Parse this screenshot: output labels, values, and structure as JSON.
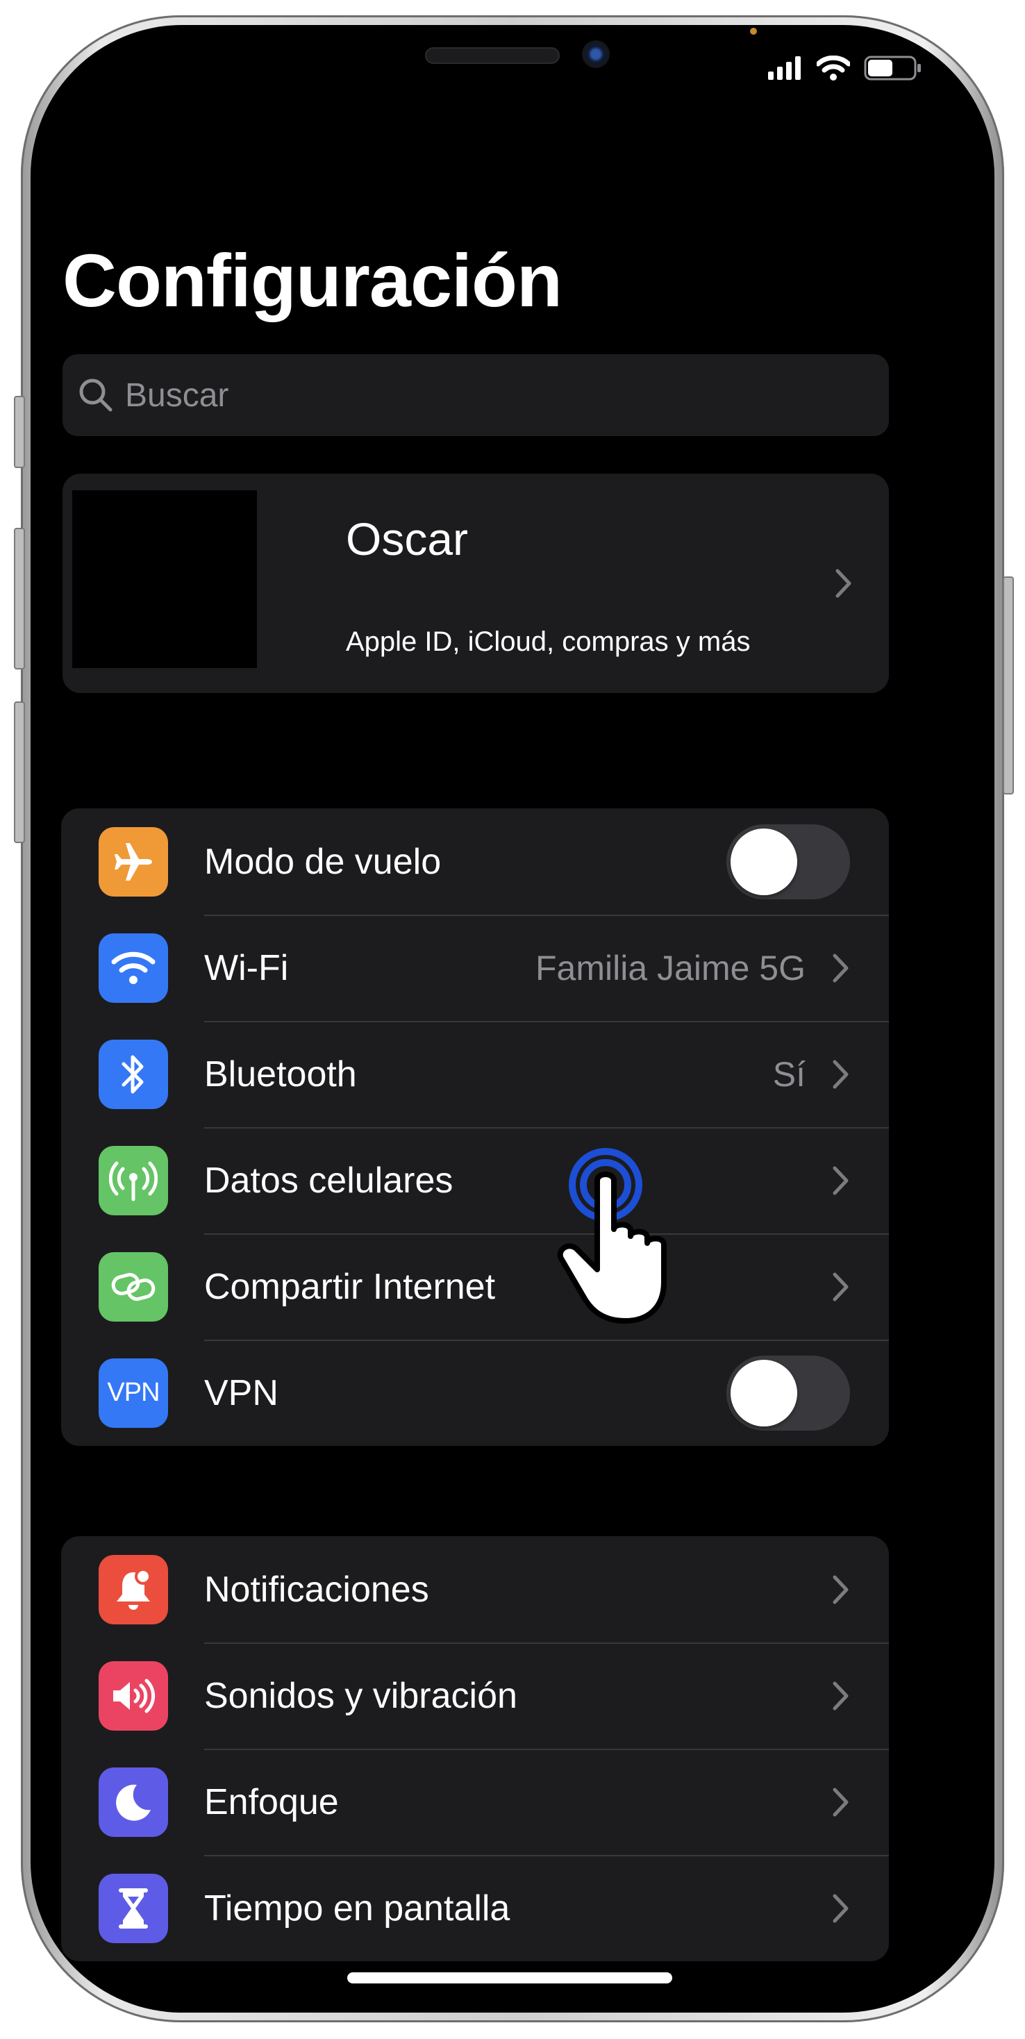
{
  "page": {
    "title": "Configuración"
  },
  "search": {
    "placeholder": "Buscar"
  },
  "profile": {
    "name": "Oscar",
    "subtitle": "Apple ID, iCloud, compras y más"
  },
  "connectivity": [
    {
      "label": "Modo de vuelo",
      "icon": "airplane-icon",
      "color": "#F09A37",
      "control": "toggle",
      "on": false
    },
    {
      "label": "Wi-Fi",
      "value": "Familia Jaime 5G",
      "icon": "wifi-icon",
      "color": "#3478F6",
      "control": "chevron"
    },
    {
      "label": "Bluetooth",
      "value": "Sí",
      "icon": "bluetooth-icon",
      "color": "#3478F6",
      "control": "chevron"
    },
    {
      "label": "Datos celulares",
      "icon": "antenna-icon",
      "color": "#65C466",
      "control": "chevron"
    },
    {
      "label": "Compartir Internet",
      "icon": "chain-link-icon",
      "color": "#65C466",
      "control": "chevron"
    },
    {
      "label": "VPN",
      "icon_text": "VPN",
      "icon": "vpn-icon",
      "color": "#3478F6",
      "control": "toggle",
      "on": false
    }
  ],
  "general": [
    {
      "label": "Notificaciones",
      "icon": "bell-icon",
      "color": "#EB4E3D"
    },
    {
      "label": "Sonidos y vibración",
      "icon": "speaker-icon",
      "color": "#EB4462"
    },
    {
      "label": "Enfoque",
      "icon": "moon-icon",
      "color": "#5E5CE6"
    },
    {
      "label": "Tiempo en pantalla",
      "icon": "hourglass-icon",
      "color": "#5E5CE6"
    }
  ],
  "status_bar": {
    "battery_level": 0.55
  }
}
